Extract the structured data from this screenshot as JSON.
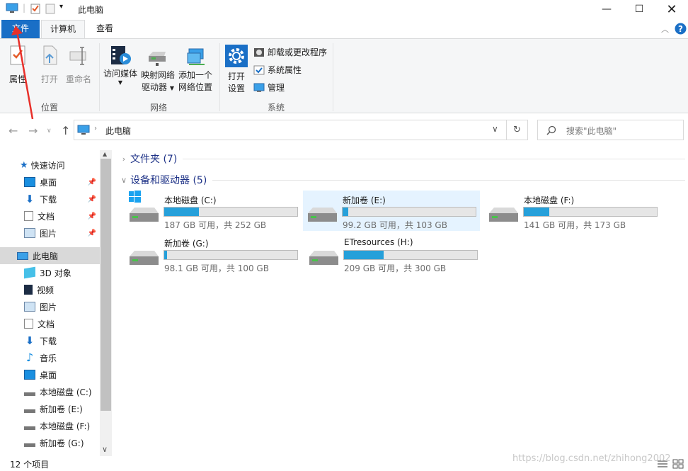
{
  "window": {
    "title": "此电脑",
    "controls": [
      "minimize",
      "maximize",
      "close"
    ]
  },
  "tabs": {
    "file": "文件",
    "computer": "计算机",
    "view": "查看"
  },
  "ribbon": {
    "location": {
      "label": "位置",
      "properties": "属性",
      "open": "打开",
      "rename": "重命名"
    },
    "network": {
      "label": "网络",
      "access_media": "访问媒体",
      "map_drive_1": "映射网络",
      "map_drive_2": "驱动器",
      "add_location_1": "添加一个",
      "add_location_2": "网络位置"
    },
    "system": {
      "label": "系统",
      "open_settings_1": "打开",
      "open_settings_2": "设置",
      "uninstall": "卸载或更改程序",
      "sys_props": "系统属性",
      "manage": "管理"
    }
  },
  "address": {
    "path": "此电脑",
    "search_placeholder": "搜索\"此电脑\""
  },
  "nav": {
    "quick_access": "快速访问",
    "quick_items": [
      "桌面",
      "下载",
      "文档",
      "图片"
    ],
    "this_pc": "此电脑",
    "pc_items": [
      "3D 对象",
      "视频",
      "图片",
      "文档",
      "下载",
      "音乐",
      "桌面",
      "本地磁盘 (C:)",
      "新加卷 (E:)",
      "本地磁盘 (F:)",
      "新加卷 (G:)"
    ]
  },
  "content": {
    "folders_group": "文件夹 (7)",
    "devices_group": "设备和驱动器 (5)",
    "drives": [
      {
        "name": "本地磁盘 (C:)",
        "free": "187 GB 可用，共 252 GB",
        "used_fraction": 0.26,
        "selected": false
      },
      {
        "name": "新加卷 (E:)",
        "free": "99.2 GB 可用，共 103 GB",
        "used_fraction": 0.04,
        "selected": true
      },
      {
        "name": "本地磁盘 (F:)",
        "free": "141 GB 可用，共 173 GB",
        "used_fraction": 0.19,
        "selected": false
      },
      {
        "name": "新加卷 (G:)",
        "free": "98.1 GB 可用，共 100 GB",
        "used_fraction": 0.02,
        "selected": false
      },
      {
        "name": "ETresources (H:)",
        "free": "209 GB 可用，共 300 GB",
        "used_fraction": 0.3,
        "selected": false
      }
    ]
  },
  "status": {
    "count": "12 个项目"
  },
  "watermark": "https://blog.csdn.net/zhihong2002",
  "colors": {
    "accent": "#1a6fc6",
    "drive_bar": "#26a0da",
    "group_heading": "#1e3287",
    "selection": "#e5f3ff",
    "annotation_arrow": "#e8302a"
  }
}
